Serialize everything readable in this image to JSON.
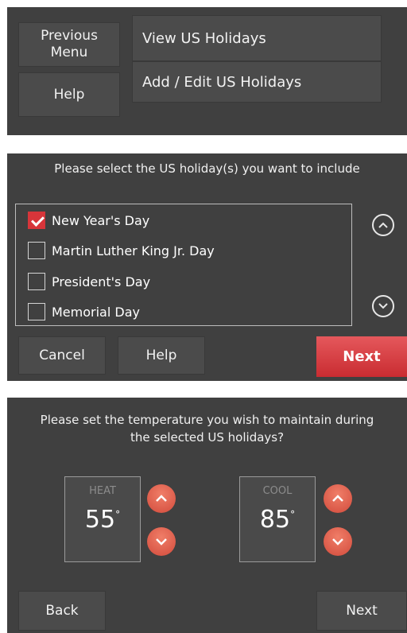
{
  "screen1": {
    "previous_menu": "Previous Menu",
    "help": "Help",
    "view_holidays": "View US Holidays",
    "add_edit_holidays": "Add / Edit US Holidays"
  },
  "screen2": {
    "prompt": "Please select the US holiday(s) you want to include",
    "holidays": [
      {
        "label": "New Year's Day",
        "checked": true
      },
      {
        "label": "Martin Luther King Jr. Day",
        "checked": false
      },
      {
        "label": "President's Day",
        "checked": false
      },
      {
        "label": "Memorial Day",
        "checked": false
      }
    ],
    "cancel": "Cancel",
    "help": "Help",
    "next": "Next"
  },
  "screen3": {
    "prompt_line1": "Please set the temperature you wish to maintain during",
    "prompt_line2": "the selected US holidays?",
    "heat_label": "HEAT",
    "heat_value": "55",
    "cool_label": "COOL",
    "cool_value": "85",
    "degree_symbol": "°",
    "back": "Back",
    "next": "Next"
  },
  "colors": {
    "panel": "#404040",
    "button": "#4b4b4b",
    "accent_red": "#d7353a"
  }
}
